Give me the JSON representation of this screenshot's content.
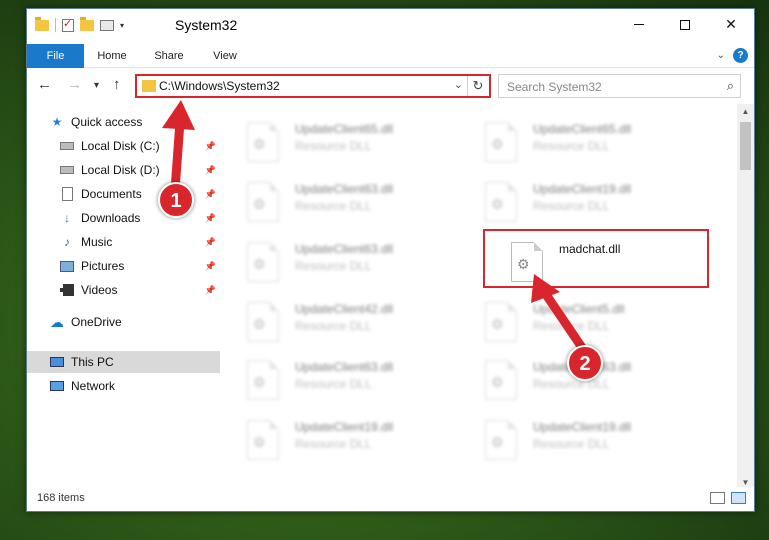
{
  "window": {
    "title": "System32",
    "controls": {
      "minimize": "—",
      "maximize": "☐",
      "close": "✕"
    }
  },
  "ribbon": {
    "tabs": [
      "File",
      "Home",
      "Share",
      "View"
    ]
  },
  "nav": {
    "back": "←",
    "forward": "→",
    "recent": "▾",
    "up": "↑",
    "address": "C:\\Windows\\System32",
    "search_placeholder": "Search System32"
  },
  "sidebar": {
    "items": [
      {
        "label": "Quick access",
        "icon": "star-icon",
        "pinned": false
      },
      {
        "label": "Local Disk (C:)",
        "icon": "drive-icon",
        "pinned": true
      },
      {
        "label": "Local Disk (D:)",
        "icon": "drive-icon",
        "pinned": true
      },
      {
        "label": "Documents",
        "icon": "documents-icon",
        "pinned": true
      },
      {
        "label": "Downloads",
        "icon": "downloads-icon",
        "pinned": true
      },
      {
        "label": "Music",
        "icon": "music-icon",
        "pinned": true
      },
      {
        "label": "Pictures",
        "icon": "pictures-icon",
        "pinned": true
      },
      {
        "label": "Videos",
        "icon": "videos-icon",
        "pinned": true
      },
      {
        "label": "OneDrive",
        "icon": "onedrive-icon",
        "pinned": false
      },
      {
        "label": "This PC",
        "icon": "this-pc-icon",
        "pinned": false
      },
      {
        "label": "Network",
        "icon": "network-icon",
        "pinned": false
      }
    ]
  },
  "files": [
    {
      "name": "UpdateClient65.dll",
      "type": "Resource DLL"
    },
    {
      "name": "UpdateClient65.dll",
      "type": "Resource DLL"
    },
    {
      "name": "UpdateClient63.dll",
      "type": "Resource DLL"
    },
    {
      "name": "UpdateClient19.dll",
      "type": "Resource DLL"
    },
    {
      "name": "UpdateClient63.dll",
      "type": "Resource DLL"
    },
    {
      "name": "madchat.dll",
      "type": ""
    },
    {
      "name": "UpdateClient42.dll",
      "type": "Resource DLL"
    },
    {
      "name": "UpdateClient5.dll",
      "type": "Resource DLL"
    },
    {
      "name": "UpdateClient63.dll",
      "type": "Resource DLL"
    },
    {
      "name": "UpdateClient63.dll",
      "type": "Resource DLL"
    },
    {
      "name": "UpdateClient19.dll",
      "type": "Resource DLL"
    },
    {
      "name": "UpdateClient19.dll",
      "type": "Resource DLL"
    }
  ],
  "status": {
    "item_count": "168 items"
  },
  "annotations": {
    "step1": "1",
    "step2": "2",
    "color": "#d9262c"
  }
}
